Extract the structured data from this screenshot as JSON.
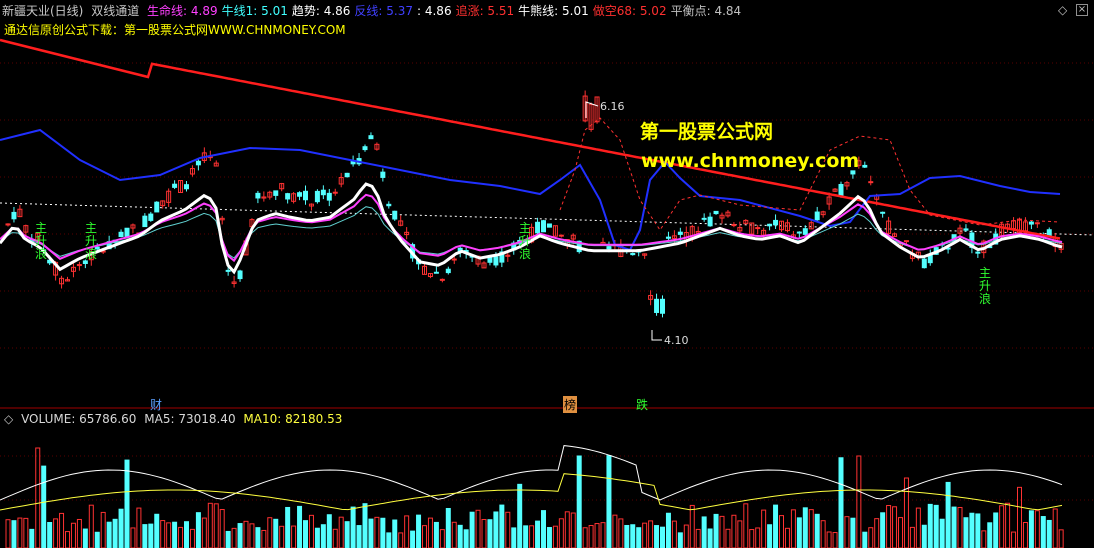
{
  "header": {
    "stock_name": "新疆天业(日线)",
    "indicator_name": "双线通道",
    "items": [
      {
        "label": "生命线",
        "value": "4.89",
        "color": "#ff40ff"
      },
      {
        "label": "牛线1",
        "value": "5.01",
        "color": "#40ffff"
      },
      {
        "label": "趋势",
        "value": "4.86",
        "color": "#ffffff"
      },
      {
        "label": "反线",
        "value": "5.37",
        "color": "#4040ff"
      },
      {
        "label": "",
        "value": "4.86",
        "color": "#ffffff"
      },
      {
        "label": "追涨",
        "value": "5.51",
        "color": "#ff3030"
      },
      {
        "label": "牛熊线",
        "value": "5.01",
        "color": "#ffffff"
      },
      {
        "label": "做空68",
        "value": "5.02",
        "color": "#ff3030"
      },
      {
        "label": "平衡点",
        "value": "4.84",
        "color": "#c0c0c0"
      }
    ]
  },
  "subtitle": "通达信原创公式下载：第一股票公式网WWW.CHNMONEY.COM",
  "watermark": {
    "line1": "第一股票公式网",
    "line2": "www.chnmoney.com"
  },
  "markers": {
    "high_label": "6.16",
    "low_label": "4.10",
    "wave_chars": [
      "主",
      "升",
      "浪"
    ],
    "event_cai": "财",
    "event_bang": "榜",
    "event_die": "跌"
  },
  "volume_header": {
    "volume": "VOLUME: 65786.60",
    "ma5": "MA5: 73018.40",
    "ma10": "MA10: 82180.53"
  },
  "chart_data": [
    {
      "type": "candlestick",
      "title": "双线通道",
      "ylim": [
        3.8,
        6.7
      ],
      "series_levels": {
        "生命线": 4.89,
        "牛线1": 5.01,
        "趋势": 4.86,
        "反线": 5.37,
        "追涨": 5.51,
        "牛熊线": 5.01,
        "做空68": 5.02,
        "平衡点": 4.84
      },
      "high": 6.16,
      "low": 4.1,
      "colors": {
        "up": "#ff3232",
        "down": "#54ffff",
        "red_line": "#ff1e1e",
        "blue_line": "#2030ff",
        "white_line": "#ffffff",
        "magenta_line": "#ff40ff",
        "cyan_line": "#60d0d0"
      }
    },
    {
      "type": "bar",
      "title": "VOLUME",
      "values": {
        "volume": 65786.6,
        "ma5": 73018.4,
        "ma10": 82180.53
      }
    }
  ]
}
